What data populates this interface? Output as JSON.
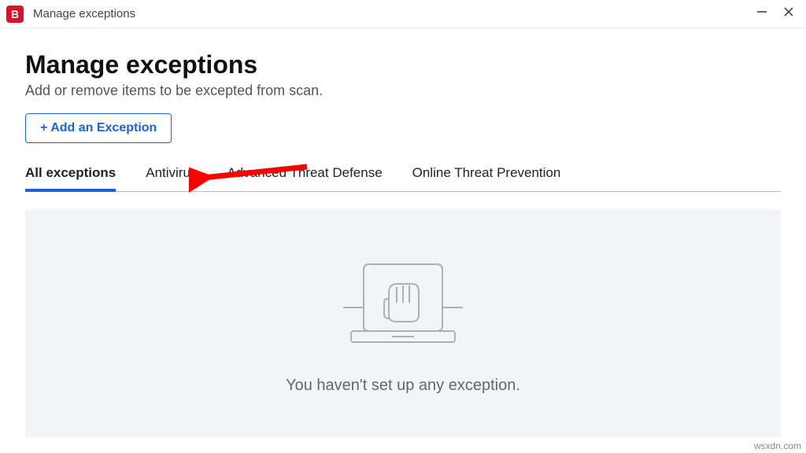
{
  "titlebar": {
    "logo_letter": "B",
    "title": "Manage exceptions"
  },
  "page": {
    "heading": "Manage exceptions",
    "subtitle": "Add or remove items to be excepted from scan.",
    "add_button_label": "+ Add an Exception"
  },
  "tabs": {
    "items": [
      {
        "label": "All exceptions",
        "active": true
      },
      {
        "label": "Antivirus",
        "active": false
      },
      {
        "label": "Advanced Threat Defense",
        "active": false
      },
      {
        "label": "Online Threat Prevention",
        "active": false
      }
    ]
  },
  "empty_state": {
    "message": "You haven't set up any exception."
  },
  "watermark": "wsxdn.com"
}
